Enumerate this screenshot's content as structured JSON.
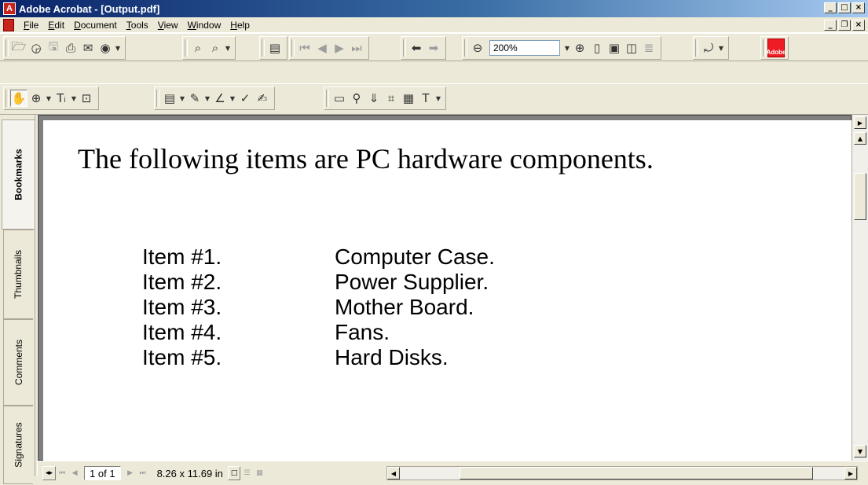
{
  "window": {
    "title": "Adobe Acrobat - [Output.pdf]",
    "app_icon_glyph": "A",
    "controls": [
      "_",
      "□",
      "×"
    ]
  },
  "mdi_controls": [
    "_",
    "❐",
    "×"
  ],
  "menubar": {
    "items": [
      {
        "accel": "F",
        "rest": "ile"
      },
      {
        "accel": "E",
        "rest": "dit"
      },
      {
        "accel": "D",
        "rest": "ocument"
      },
      {
        "accel": "T",
        "rest": "ools"
      },
      {
        "accel": "V",
        "rest": "iew"
      },
      {
        "accel": "W",
        "rest": "indow"
      },
      {
        "accel": "H",
        "rest": "elp"
      }
    ]
  },
  "toolbar1": {
    "zoom_value": "200%",
    "icons": {
      "open": "🗁",
      "organizer": "◶",
      "save": "🖫",
      "print": "⎙",
      "email": "✉",
      "web": "◉",
      "search": "⌕",
      "find": "⌕",
      "nav_pane": "▤",
      "first": "⏮",
      "prev": "◀",
      "next": "▶",
      "last": "⏭",
      "back": "⬅",
      "forward": "➡",
      "zoom_out": "⊖",
      "zoom_in": "⊕",
      "actual_size": "▯",
      "fit_page": "▣",
      "fit_width": "◫",
      "reflow": "≣",
      "rotate": "⤾"
    },
    "adobe_label": "Adobe"
  },
  "toolbar2": {
    "icons": {
      "hand": "✋",
      "zoom": "⊕",
      "text_select": "Tᵢ",
      "snapshot": "⊡",
      "note": "▤",
      "pencil": "✎",
      "line": "∠",
      "spell": "✓",
      "sign": "✍",
      "movie": "▭",
      "link": "⚲",
      "article": "⇓",
      "crop": "⌗",
      "form": "▦",
      "touchup": "T"
    }
  },
  "nav_tabs": [
    {
      "label": "Bookmarks",
      "active": true
    },
    {
      "label": "Thumbnails",
      "active": false
    },
    {
      "label": "Comments",
      "active": false
    },
    {
      "label": "Signatures",
      "active": false
    }
  ],
  "document": {
    "heading": "The following items are PC hardware components.",
    "items": [
      {
        "num": "Item #1.",
        "text": "Computer Case."
      },
      {
        "num": "Item #2.",
        "text": "Power Supplier."
      },
      {
        "num": "Item #3.",
        "text": "Mother Board."
      },
      {
        "num": "Item #4.",
        "text": "Fans."
      },
      {
        "num": "Item #5.",
        "text": "Hard Disks."
      }
    ]
  },
  "statusbar": {
    "page_indicator": "1 of 1",
    "page_size": "8.26 x 11.69 in",
    "icons": {
      "split": "◂▸",
      "first": "⏮",
      "prev": "◀",
      "next": "▶",
      "last": "⏭",
      "single": "□",
      "continuous": "☰",
      "facing": "▦"
    }
  },
  "scrollbar": {
    "up": "▲",
    "down": "▼",
    "left": "◀",
    "right": "▶"
  }
}
